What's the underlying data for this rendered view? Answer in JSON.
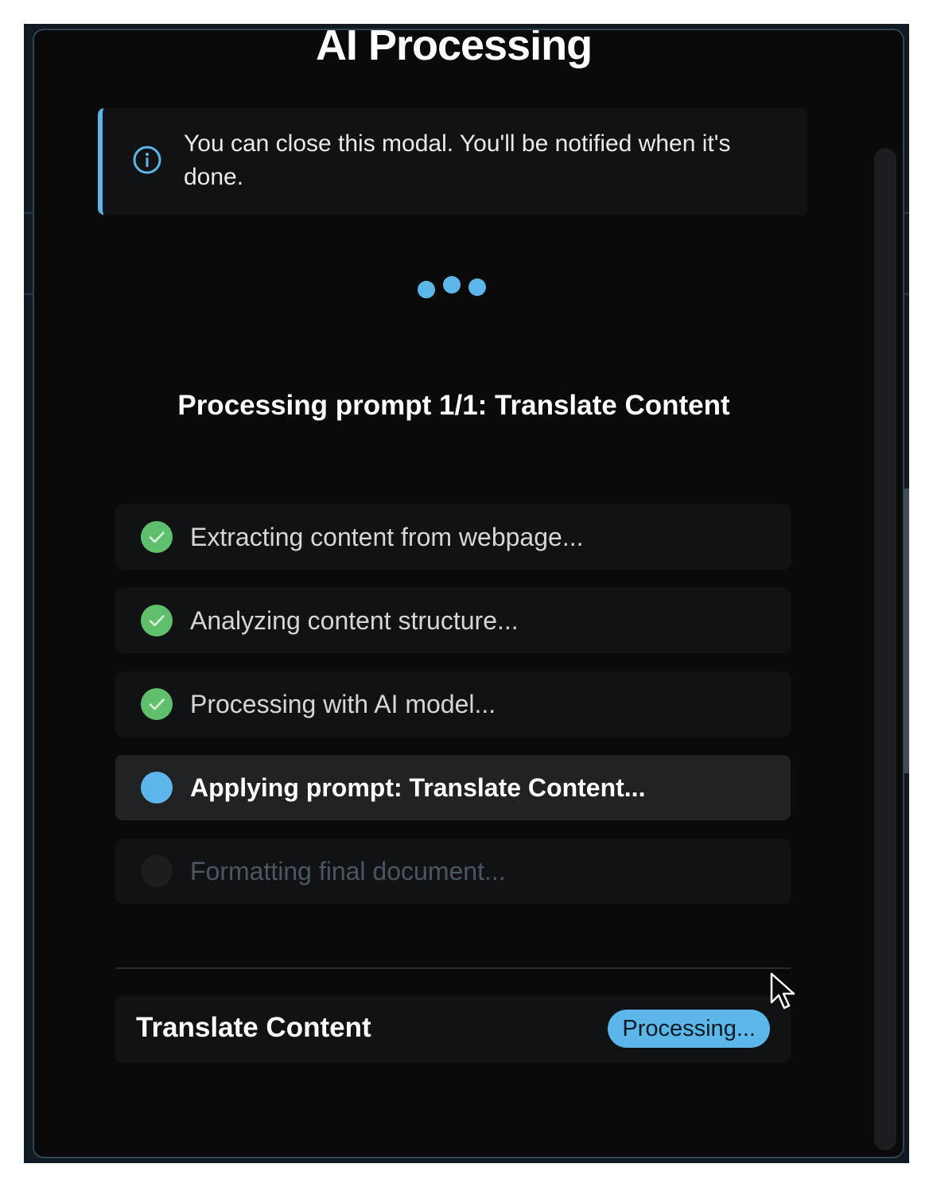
{
  "modal": {
    "title": "AI Processing",
    "info_message": "You can close this modal. You'll be notified when it's done.",
    "status_heading": "Processing prompt 1/1: Translate Content"
  },
  "steps": [
    {
      "label": "Extracting content from webpage...",
      "state": "done"
    },
    {
      "label": "Analyzing content structure...",
      "state": "done"
    },
    {
      "label": "Processing with AI model...",
      "state": "done"
    },
    {
      "label": "Applying prompt: Translate Content...",
      "state": "active"
    },
    {
      "label": "Formatting final document...",
      "state": "pending"
    }
  ],
  "task": {
    "name": "Translate Content",
    "status": "Processing..."
  },
  "colors": {
    "accent": "#5db6e8",
    "success": "#5fbf6c",
    "background": "#0a0a0a"
  },
  "icons": {
    "info": "info-circle-icon",
    "done": "check-icon",
    "loader": "loading-dots-icon"
  }
}
